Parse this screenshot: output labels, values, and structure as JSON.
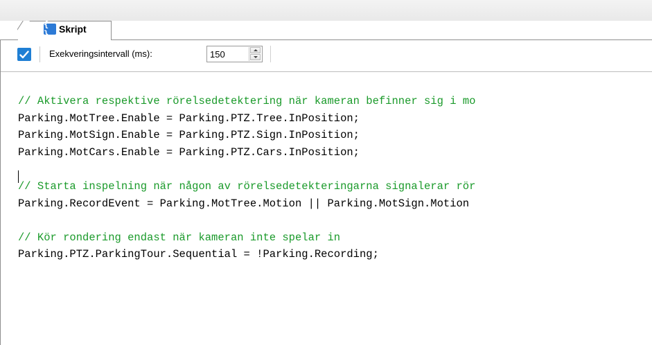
{
  "tab": {
    "label": "Skript",
    "icon": "braces-icon",
    "icon_glyph": "{ }"
  },
  "toolbar": {
    "check_icon": "checkmark-icon",
    "interval_label": "Exekveringsintervall (ms):",
    "interval_value": "150"
  },
  "editor": {
    "lines": [
      {
        "kind": "comment",
        "text": "// Aktivera respektive rörelsedetektering när kameran befinner sig i mo"
      },
      {
        "kind": "code",
        "text": "Parking.MotTree.Enable = Parking.PTZ.Tree.InPosition;"
      },
      {
        "kind": "code",
        "text": "Parking.MotSign.Enable = Parking.PTZ.Sign.InPosition;"
      },
      {
        "kind": "code",
        "text": "Parking.MotCars.Enable = Parking.PTZ.Cars.InPosition;"
      },
      {
        "kind": "blank",
        "text": ""
      },
      {
        "kind": "comment",
        "text": "// Starta inspelning när någon av rörelsedetekteringarna signalerar rör"
      },
      {
        "kind": "code",
        "text": "Parking.RecordEvent = Parking.MotTree.Motion || Parking.MotSign.Motion"
      },
      {
        "kind": "blank",
        "text": ""
      },
      {
        "kind": "comment",
        "text": "// Kör rondering endast när kameran inte spelar in"
      },
      {
        "kind": "code",
        "text": "Parking.PTZ.ParkingTour.Sequential = !Parking.Recording;"
      }
    ]
  },
  "colors": {
    "comment": "#1a9a2a",
    "code": "#000000",
    "accent": "#1f7fd4"
  }
}
